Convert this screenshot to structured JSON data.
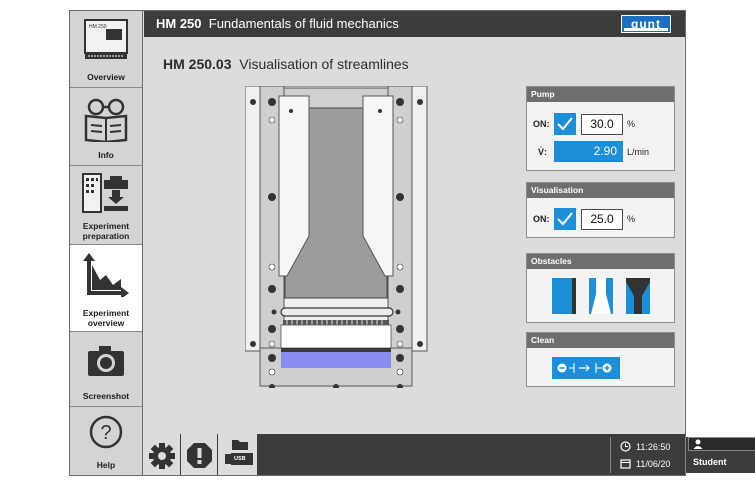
{
  "header": {
    "title_bold": "HM 250",
    "title_rest": "Fundamentals of fluid mechanics",
    "logo_text": "gunt"
  },
  "page": {
    "title_bold": "HM 250.03",
    "title_rest": "Visualisation of streamlines"
  },
  "sidebar": {
    "items": [
      {
        "label": "Overview",
        "active": false
      },
      {
        "label": "Info",
        "active": false
      },
      {
        "label": "Experiment\npreparation",
        "active": false
      },
      {
        "label": "Experiment\noverview",
        "active": true
      },
      {
        "label": "Screenshot",
        "active": false
      },
      {
        "label": "Help",
        "active": false
      }
    ]
  },
  "pump": {
    "title": "Pump",
    "on_label": "ON:",
    "on_checked": true,
    "percent_value": "30.0",
    "percent_unit": "%",
    "flow_label": "V̇:",
    "flow_value": "2.90",
    "flow_unit": "L/min"
  },
  "visualisation": {
    "title": "Visualisation",
    "on_label": "ON:",
    "on_checked": true,
    "value": "25.0",
    "unit": "%"
  },
  "obstacles": {
    "title": "Obstacles"
  },
  "clean": {
    "title": "Clean"
  },
  "footer": {
    "time": "11:26:50",
    "date": "11/06/20",
    "user": "Student",
    "usb_label": "USB"
  },
  "colors": {
    "accent": "#1d8fd8",
    "header": "#3c3c3c",
    "background": "#dcdcdc"
  }
}
